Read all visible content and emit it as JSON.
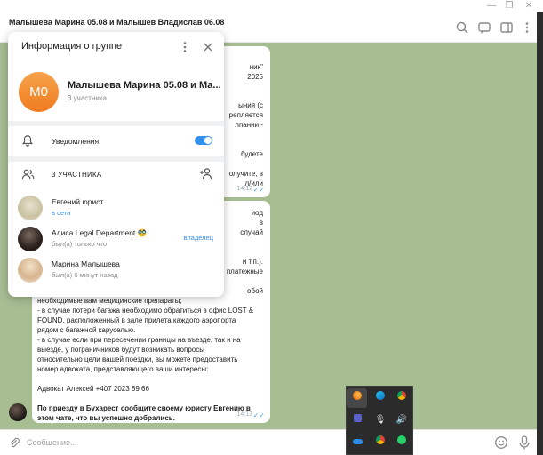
{
  "chat": {
    "title": "Малышева Марина 05.08 и Малышев Владислав 06.08",
    "top_bubble_fragments": [
      "ник\"",
      "2025",
      "ыния (с",
      "репляется",
      "лпании -",
      "будете",
      "олучите, в",
      "л/или"
    ],
    "top_time": "14:12",
    "bottom_bubble_fragments": [
      "иод",
      "в",
      "случай",
      "и т.п.).",
      "платежные",
      "обой"
    ],
    "bottom_bubble_lines": [
      "необходимые вам медицинские препараты;",
      "- в случае потери багажа необходимо обратиться в офис LOST &",
      "FOUND, расположенный в зале прилета каждого аэропорта",
      "рядом с багажной каруселью.",
      "- в случае если при пересечении границы на въезде, так и на",
      "выезде, у пограничников будут возникать вопросы",
      "относительно цели вашей поездки, вы можете предоставить",
      "номер адвоката, представляющего ваши интересы:",
      "",
      "Адвокат Алексей +407 2023 89 66",
      ""
    ],
    "bottom_bubble_bold": [
      "По приезду в Бухарест сообщите своему юристу Евгению в",
      "этом чате, что вы успешно добрались."
    ],
    "bottom_time": "14:13",
    "composer_placeholder": "Сообщение..."
  },
  "panel": {
    "title": "Информация о группе",
    "avatar_initials": "М0",
    "group_name": "Малышева Марина 05.08 и Ма...",
    "member_count": "3 участника",
    "notifications_label": "Уведомления",
    "notifications_enabled": true,
    "members_header": "3 УЧАСТНИКА",
    "members": [
      {
        "name": "Евгений юрист",
        "status": "в сети",
        "online": true,
        "role": ""
      },
      {
        "name": "Алиса Legal Department 🥸",
        "status": "был(а) только что",
        "online": false,
        "role": "владелец"
      },
      {
        "name": "Марина Малышева",
        "status": "был(а) 6 минут назад",
        "online": false,
        "role": ""
      }
    ]
  },
  "colors": {
    "accent": "#3390ec",
    "avatar_orange": "#f08a2e",
    "chat_background": "#a7bd92"
  },
  "tray": {
    "icons": [
      "firefox-icon",
      "edge-icon",
      "chrome-notify-icon",
      "teams-icon",
      "microphone-icon",
      "volume-icon",
      "onedrive-icon",
      "chrome-icon",
      "whatsapp-icon"
    ]
  }
}
